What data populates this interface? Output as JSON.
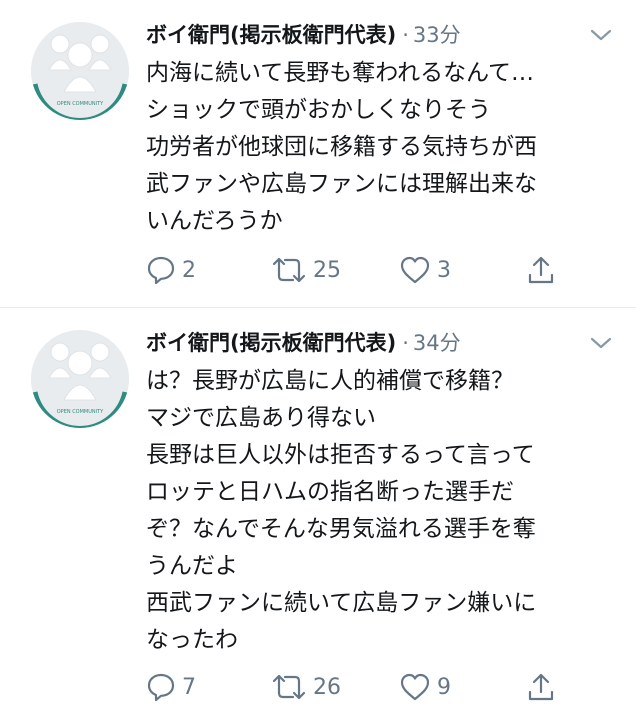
{
  "tweets": [
    {
      "author_name": "ボイ衛門(掲示板衛門代表)",
      "separator": "·",
      "time": "33分",
      "avatar_caption": "OPEN COMMUNITY",
      "lines": [
        "内海に続いて長野も奪われるなんて…",
        "ショックで頭がおかしくなりそう",
        "功労者が他球団に移籍する気持ちが西",
        "武ファンや広島ファンには理解出来な",
        "いんだろうか"
      ],
      "replies": "2",
      "retweets": "25",
      "likes": "3"
    },
    {
      "author_name": "ボイ衛門(掲示板衛門代表)",
      "separator": "·",
      "time": "34分",
      "avatar_caption": "OPEN COMMUNITY",
      "lines": [
        "は？長野が広島に人的補償で移籍？",
        "マジで広島あり得ない",
        "長野は巨人以外は拒否するって言って",
        "ロッテと日ハムの指名断った選手だ",
        "ぞ？なんでそんな男気溢れる選手を奪",
        "うんだよ",
        "西武ファンに続いて広島ファン嫌いに",
        "なったわ"
      ],
      "replies": "7",
      "retweets": "26",
      "likes": "9"
    }
  ],
  "colors": {
    "text": "#14171a",
    "muted": "#657786",
    "divider": "#e6ecf0",
    "avatar_ring": "#2e8b82",
    "avatar_bg": "#e9ecee"
  },
  "icons": {
    "more": "chevron-down-icon",
    "reply": "speech-bubble-icon",
    "retweet": "retweet-arrows-icon",
    "like": "heart-icon",
    "share": "share-upload-icon"
  }
}
